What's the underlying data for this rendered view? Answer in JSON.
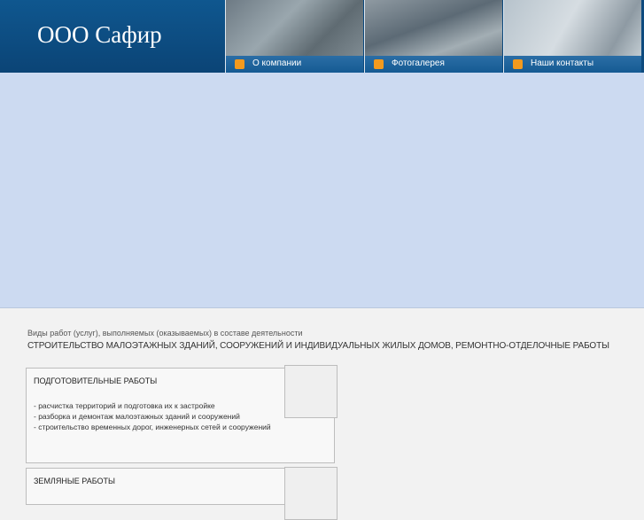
{
  "header": {
    "logo": "ООО Сафир"
  },
  "nav": [
    {
      "label": "О компании",
      "icon": "bullet-square-icon"
    },
    {
      "label": "Фотогалерея",
      "icon": "bullet-square-icon"
    },
    {
      "label": "Наши контакты",
      "icon": "bullet-square-icon"
    }
  ],
  "content": {
    "intro": "Виды работ (услуг), выполняемых (оказываемых) в составе деятельности",
    "activity": "СТРОИТЕЛЬСТВО МАЛОЭТАЖНЫХ ЗДАНИЙ, СООРУЖЕНИЙ И ИНДИВИДУАЛЬНЫХ ЖИЛЫХ ДОМОВ, РЕМОНТНО-ОТДЕЛОЧНЫЕ РАБОТЫ",
    "cards": [
      {
        "title": "ПОДГОТОВИТЕЛЬНЫЕ РАБОТЫ",
        "items": [
          "- расчистка территорий и подготовка их к застройке",
          "- разборка и демонтаж малоэтажных зданий и сооружений",
          "- строительство временных дорог, инженерных сетей и сооружений"
        ]
      },
      {
        "title": "ЗЕМЛЯНЫЕ РАБОТЫ"
      }
    ]
  },
  "colors": {
    "header": "#0d4a7e",
    "banner": "#ccdaf1",
    "accent": "#f39a1e",
    "navBar": "#155a93"
  }
}
